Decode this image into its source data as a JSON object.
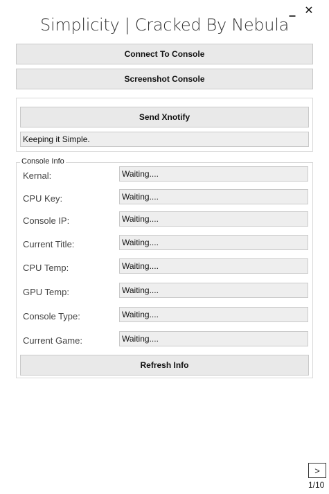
{
  "window": {
    "title": "Simplicity | Cracked By Nebula",
    "minimize_glyph": "_",
    "close_glyph": "✕"
  },
  "actions": {
    "connect_label": "Connect To Console",
    "screenshot_label": "Screenshot Console"
  },
  "notify": {
    "send_label": "Send Xnotify",
    "message_value": "Keeping it Simple."
  },
  "console_info": {
    "legend": "Console Info",
    "rows": [
      {
        "label": "Kernal:",
        "value": "Waiting...."
      },
      {
        "label": "CPU Key:",
        "value": "Waiting...."
      },
      {
        "label": "Console IP:",
        "value": "Waiting...."
      },
      {
        "label": "Current Title:",
        "value": "Waiting...."
      },
      {
        "label": "CPU Temp:",
        "value": "Waiting...."
      },
      {
        "label": "GPU Temp:",
        "value": "Waiting...."
      },
      {
        "label": "Console Type:",
        "value": "Waiting...."
      },
      {
        "label": "Current Game:",
        "value": "Waiting...."
      }
    ],
    "refresh_label": "Refresh Info"
  },
  "pager": {
    "next_label": ">",
    "page_indicator": "1/10"
  }
}
